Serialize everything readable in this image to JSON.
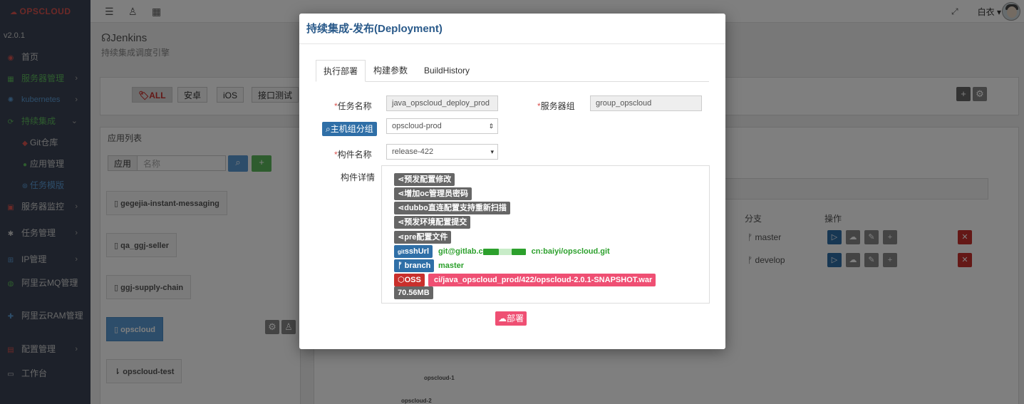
{
  "sidebar": {
    "logo": "OPSCLOUD",
    "version": "v2.0.1",
    "items": [
      {
        "label": "首页"
      },
      {
        "label": "服务器管理"
      },
      {
        "label": "kubernetes"
      },
      {
        "label": "持续集成"
      },
      {
        "label": "Git仓库"
      },
      {
        "label": "应用管理"
      },
      {
        "label": "任务模版"
      },
      {
        "label": "服务器监控"
      },
      {
        "label": "任务管理"
      },
      {
        "label": "IP管理"
      },
      {
        "label": "阿里云MQ管理"
      },
      {
        "label": "阿里云RAM管理"
      },
      {
        "label": "配置管理"
      },
      {
        "label": "工作台"
      }
    ]
  },
  "topbar": {
    "user": "白衣"
  },
  "page": {
    "title": "Jenkins",
    "subtitle": "持续集成调度引擎",
    "filters": [
      "ALL",
      "安卓",
      "iOS",
      "接口测试"
    ],
    "app_list_title": "应用列表",
    "app_search_label": "应用",
    "app_search_placeholder": "名称",
    "apps": [
      "gegejia-instant-messaging",
      "qa_ggj-seller",
      "ggj-supply-chain",
      "opscloud",
      "opscloud-test"
    ],
    "table_headers": {
      "branch": "分支",
      "actions": "操作"
    },
    "rows": [
      {
        "branch": "master"
      },
      {
        "branch": "develop"
      }
    ],
    "nodes": [
      "opscloud-1",
      "opscloud-2"
    ]
  },
  "modal": {
    "title": "持续集成-发布(Deployment)",
    "tabs": [
      "执行部署",
      "构建参数",
      "BuildHistory"
    ],
    "task_name_label": "任务名称",
    "task_name_value": "java_opscloud_deploy_prod",
    "server_group_label": "服务器组",
    "server_group_value": "group_opscloud",
    "host_group_button": "主机组分组",
    "host_group_value": "opscloud-prod",
    "artifact_label": "构件名称",
    "artifact_value": "release-422",
    "details_label": "构件详情",
    "commits": [
      "预发配置修改",
      "增加oc管理员密码",
      "dubbo直连配置支持重新扫描",
      "预发环境配置提交",
      "pre配置文件"
    ],
    "ssh_url_label": "sshUrl",
    "ssh_url_prefix": "git@gitlab.c",
    "ssh_url_suffix": "cn:baiyi/opscloud.git",
    "branch_label": "branch",
    "branch_value": "master",
    "oss_label": "OSS",
    "oss_path": "ci/java_opscloud_prod/422/opscloud-2.0.1-SNAPSHOT.war",
    "size": "70.56MB",
    "deploy_button": "部署"
  }
}
